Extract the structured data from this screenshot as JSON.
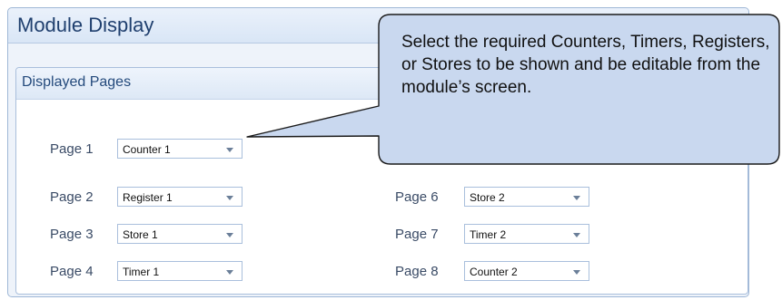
{
  "panel": {
    "title": "Module Display"
  },
  "group": {
    "title": "Displayed Pages"
  },
  "pages": [
    {
      "label": "Page 1",
      "value": "Counter 1"
    },
    {
      "label": "Page 2",
      "value": "Register 1"
    },
    {
      "label": "Page 3",
      "value": "Store 1"
    },
    {
      "label": "Page 4",
      "value": "Timer 1"
    },
    {
      "label": "Page 6",
      "value": "Store 2"
    },
    {
      "label": "Page 7",
      "value": "Timer 2"
    },
    {
      "label": "Page 8",
      "value": "Counter 2"
    }
  ],
  "callout": {
    "text": "Select the required Counters, Timers, Registers, or Stores to be shown and be editable from the module’s screen."
  },
  "colors": {
    "accent": "#1f3f6e",
    "callout_fill": "#c9d8ef",
    "callout_border": "#1a1a1a"
  }
}
